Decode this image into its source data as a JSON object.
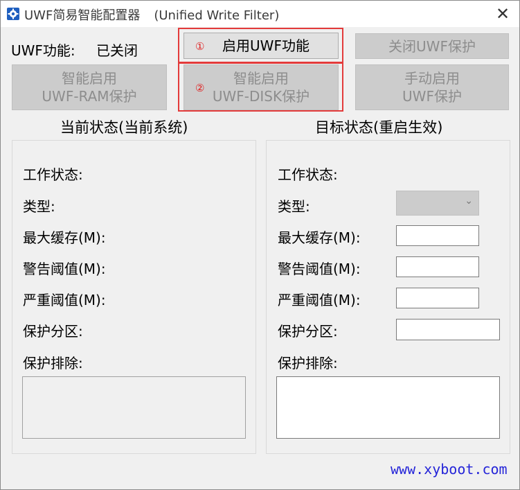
{
  "window": {
    "title": "UWF简易智能配置器",
    "subtitle": "(Unified Write Filter)",
    "close_symbol": "✕"
  },
  "status": {
    "label": "UWF功能:",
    "value": "已关闭"
  },
  "buttons": {
    "enable_uwf": {
      "marker": "①",
      "label": "启用UWF功能"
    },
    "close_uwf": {
      "label": "关闭UWF保护"
    },
    "smart_ram": {
      "line1": "智能启用",
      "line2": "UWF-RAM保护"
    },
    "smart_disk": {
      "marker": "②",
      "line1": "智能启用",
      "line2": "UWF-DISK保护"
    },
    "manual": {
      "line1": "手动启用",
      "line2": "UWF保护"
    }
  },
  "current": {
    "title": "当前状态(当前系统)",
    "fields": [
      "工作状态:",
      "类型:",
      "最大缓存(M):",
      "警告阈值(M):",
      "严重阈值(M):",
      "保护分区:",
      "保护排除:"
    ]
  },
  "target": {
    "title": "目标状态(重启生效)",
    "fields": [
      "工作状态:",
      "类型:",
      "最大缓存(M):",
      "警告阈值(M):",
      "严重阈值(M):",
      "保护分区:",
      "保护排除:"
    ],
    "type_value": ""
  },
  "footer": {
    "link": "www.xyboot.com"
  },
  "colors": {
    "highlight": "#e33a3a",
    "link": "#2424d8",
    "disabled_text": "#8d8d8d"
  }
}
